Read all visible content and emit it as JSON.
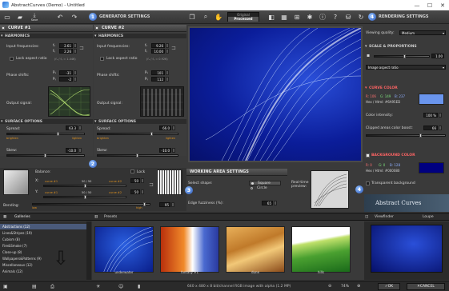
{
  "window": {
    "title": "AbstractCurves (Demo) - Untitled",
    "controls": [
      "—",
      "☐",
      "✕"
    ]
  },
  "toolbar": {
    "save_label": "Save",
    "original": "Original",
    "processed": "Processed",
    "step1": "1",
    "step2": "2",
    "step3": "3",
    "step4": "4",
    "generator_settings": "GENERATOR SETTINGS",
    "rendering_settings": "RENDERING SETTINGS"
  },
  "curve1": {
    "title": "CURVE #1",
    "harmonics": "HARMONICS",
    "input_freq": "Input frequencies:",
    "fx": "2.61",
    "fy": "2.26",
    "lock_aspect": "Lock aspect ratio",
    "lock_hint": "(fₓ / fᵧ = 1.446)",
    "phase_shifts": "Phase shifts:",
    "px": "-31",
    "py": "-2",
    "output_signal": "Output signal:",
    "surface_options": "SURFACE OPTIONS",
    "spread": "Spread:",
    "spread_val": "63.3",
    "spread_left": "brighten",
    "spread_right": "lighten",
    "skew": "Skew:",
    "skew_val": "-10.0"
  },
  "curve2": {
    "title": "CURVE #2",
    "harmonics": "HARMONICS",
    "input_freq": "Input frequencies:",
    "fx": "9.26",
    "fy": "10.00",
    "lock_aspect": "Lock aspect ratio",
    "lock_hint": "(fₓ / fᵧ = 0.926)",
    "phase_shifts": "Phase shifts:",
    "px": "101",
    "py": "112",
    "output_signal": "Output signal:",
    "surface_options": "SURFACE OPTIONS",
    "spread": "Spread:",
    "spread_val": "66.0",
    "spread_left": "brighten",
    "spread_right": "lighten",
    "skew": "Skew:",
    "skew_val": "-10.0"
  },
  "balance": {
    "title": "Balance:",
    "lock": "Lock",
    "x_label": "X:",
    "x_left": "curve #1",
    "x_right": "curve #2",
    "x_mid": "50 / 50",
    "x_val": "50",
    "y_label": "Y:",
    "y_left": "curve #1",
    "y_right": "curve #2",
    "y_mid": "50 / 50",
    "y_val": "50"
  },
  "bending": {
    "label": "Bending:",
    "low": "low",
    "high": "high",
    "val": "95"
  },
  "working_area": {
    "title": "WORKING AREA SETTINGS",
    "select_shape": "Select shape:",
    "square": "Square",
    "circle": "Circle",
    "edge_fuzziness": "Edge fuzziness (%):",
    "edge_val": "65",
    "realtime_preview": "Real-time preview:"
  },
  "rendering": {
    "viewing_quality": "Viewing quality:",
    "quality_val": "Medium",
    "scale_proportions": "SCALE & PROPORTIONS",
    "scale_val": "1.00",
    "aspect_select": "Image aspect ratio",
    "curve_color": "CURVE COLOR",
    "r": "R: 106",
    "g": "G: 149",
    "b": "B: 237",
    "hex": "Hex / Html:  #6A95ED",
    "color_intensity": "Color intensity:",
    "intensity_val": "100 %",
    "clipped_boost": "Clipped areas color boost:",
    "boost_val": "66",
    "bg_color": "BACKGROUND COLOR",
    "bg_r": "R: 0",
    "bg_g": "G: 0",
    "bg_b": "B: 128",
    "bg_hex": "Hex / Html:  #000080",
    "transparent": "Transparent background"
  },
  "brand": {
    "logo": "Abstract Curves"
  },
  "bottom_tabs": {
    "galleries": "Galleries",
    "presets": "Presets",
    "viewfinder": "Viewfinder",
    "loupe": "Loupe"
  },
  "gallery": {
    "categories": [
      "Abstractions (12)",
      "Lines&Stripes (19)",
      "Cubism (8)",
      "Fire&Smoke (7)",
      "Close-up (8)",
      "Wallpapers&Patterns (9)",
      "Miscellaneous (12)",
      "Animals (12)"
    ],
    "thumbs": [
      "underwater",
      "fantasy #1",
      "dune",
      "hills"
    ]
  },
  "status": {
    "text": "640 x 480 x 8 bit/channel RGB image with alpha  (1.2 MP)",
    "zoom": "74%",
    "ok": "OK",
    "cancel": "CANCEL"
  }
}
